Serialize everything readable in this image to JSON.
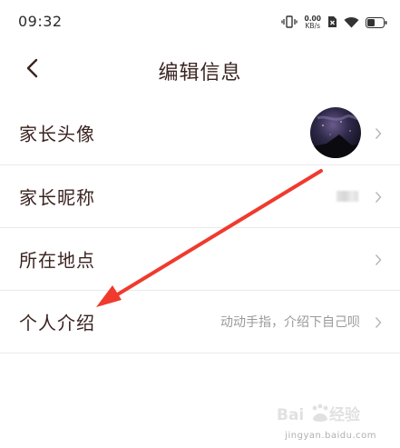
{
  "status_bar": {
    "time": "09:32",
    "net_speed_value": "0.00",
    "net_speed_unit": "KB/s",
    "icons": [
      "vibrate-icon",
      "sim-off-icon",
      "wifi-icon",
      "battery-icon"
    ]
  },
  "header": {
    "title": "编辑信息",
    "back_icon": "chevron-left-icon"
  },
  "rows": [
    {
      "label": "家长头像",
      "type": "avatar"
    },
    {
      "label": "家长昵称",
      "type": "blurred"
    },
    {
      "label": "所在地点",
      "value": ""
    },
    {
      "label": "个人介绍",
      "value": "动动手指，介绍下自己呗"
    }
  ],
  "annotation": {
    "color": "#f03a2e"
  },
  "watermark": {
    "text": "jingyan.baidu.com",
    "logo_text": "Baidu经验"
  },
  "colors": {
    "text": "#3a2420",
    "value_text": "#9a9a9a",
    "divider": "#e9e9e9",
    "chevron": "#b5b5b5"
  }
}
